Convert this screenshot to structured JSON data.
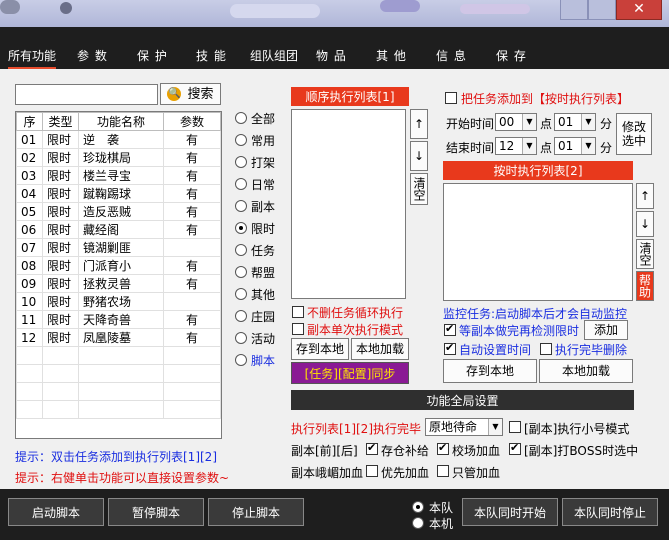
{
  "tabs": [
    "所有功能",
    "参 数",
    "保 护",
    "技 能",
    "组队组团",
    "物 品",
    "其 他",
    "信 息",
    "保 存"
  ],
  "search": {
    "button_label": "搜索",
    "value": ""
  },
  "table": {
    "headers": [
      "序",
      "类型",
      "功能名称",
      "参数"
    ],
    "rows": [
      [
        "01",
        "限时",
        "逆　袭",
        "有"
      ],
      [
        "02",
        "限时",
        "珍珑棋局",
        "有"
      ],
      [
        "03",
        "限时",
        "楼兰寻宝",
        "有"
      ],
      [
        "04",
        "限时",
        "蹴鞠踢球",
        "有"
      ],
      [
        "05",
        "限时",
        "造反恶贼",
        "有"
      ],
      [
        "06",
        "限时",
        "藏经阁",
        "有"
      ],
      [
        "07",
        "限时",
        "镜湖剿匪",
        ""
      ],
      [
        "08",
        "限时",
        "门派育小",
        "有"
      ],
      [
        "09",
        "限时",
        "拯救灵兽",
        "有"
      ],
      [
        "10",
        "限时",
        "野猪农场",
        ""
      ],
      [
        "11",
        "限时",
        "天降奇兽",
        "有"
      ],
      [
        "12",
        "限时",
        "凤凰陵墓",
        "有"
      ]
    ]
  },
  "categories": [
    "全部",
    "常用",
    "打架",
    "日常",
    "副本",
    "限时",
    "任务",
    "帮盟",
    "其他",
    "庄园",
    "活动",
    "脚本"
  ],
  "selected_category": "限时",
  "tips": {
    "tip1": "提示：双击任务添加到执行列表[1][2]",
    "tip2": "提示：右健单击功能可以直接设置参数~"
  },
  "seq_list": {
    "header": "顺序执行列表[1]",
    "up": "↑",
    "down": "↓",
    "clear": "清空",
    "no_loop": "不删任务循环执行",
    "single_mode": "副本单次执行模式",
    "save_local": "存到本地",
    "load_local": "本地加载",
    "sync": "[任务][配置]同步"
  },
  "timed": {
    "add_to_timed": "把任务添加到【按时执行列表】",
    "start_label": "开始时间",
    "start_hour": "00",
    "start_min": "01",
    "end_label": "结束时间",
    "end_hour": "12",
    "end_min": "01",
    "point": "点",
    "minute": "分",
    "modify": "修改选中",
    "header": "按时执行列表[2]",
    "up": "↑",
    "down": "↓",
    "clear": "清空",
    "help": "帮助",
    "monitor_label": "监控任务:",
    "monitor_desc": "启动脚本后才会自动监控",
    "wait_dungeon": "等副本做完再检测限时",
    "add": "添加",
    "auto_time": "自动设置时间",
    "delete_done": "执行完毕删除",
    "save_local": "存到本地",
    "load_local": "本地加载"
  },
  "global": {
    "header": "功能全局设置",
    "exec_label": "执行列表[1][2]执行完毕",
    "exec_value": "原地待命",
    "small_mode": "[副本]执行小号模式",
    "dungeon_prefix": "副本[前][后]",
    "warehouse": "存仓补给",
    "arena": "校场加血",
    "boss": "[副本]打BOSS时选中",
    "emei": "副本峨嵋加血",
    "priority": "优先加血",
    "only": "只管加血"
  },
  "bottom": {
    "start": "启动脚本",
    "pause": "暂停脚本",
    "stop": "停止脚本",
    "team": "本队",
    "machine": "本机",
    "team_start": "本队同时开始",
    "team_stop": "本队同时停止"
  },
  "colors": {
    "accent_red": "#e8391c",
    "tip_blue": "#1a2ee0",
    "tip_red": "#e01010",
    "sync_purple": "#8a1a94"
  }
}
